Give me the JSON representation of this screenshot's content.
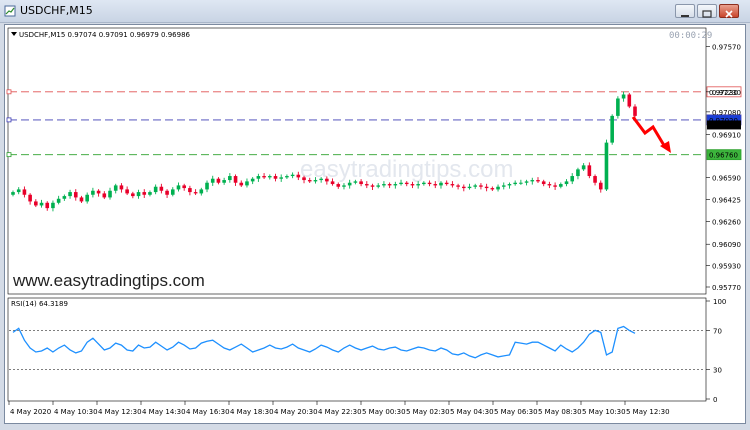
{
  "window": {
    "title": "USDCHF,M15",
    "buttons": [
      "minimize-icon",
      "restore-icon",
      "close-icon"
    ]
  },
  "chart_header": {
    "symbol_line": "USDCHF,M15  0.97074 0.97091 0.96979 0.96986",
    "timer": "00:00:29"
  },
  "watermarks": {
    "main": "www.easytradingtips.com",
    "faint": "easytradingtips.com"
  },
  "colors": {
    "bull": "#00b050",
    "bear": "#e8002a",
    "line_red": "#e05050",
    "line_blue": "#3c3cb4",
    "line_green": "#2ca02c",
    "rsi": "#1e90ff",
    "arrow": "#ff0000"
  },
  "chart_data": {
    "type": "candlestick",
    "price_axis_ticks": [
      "0.97570",
      "0.97230",
      "0.97080",
      "0.96910",
      "0.96590",
      "0.96425",
      "0.96260",
      "0.96090",
      "0.95930",
      "0.95770"
    ],
    "ylim": [
      0.9577,
      0.9767
    ],
    "horizontal_lines": [
      {
        "label": "0.97230",
        "value": 0.9723,
        "color": "red"
      },
      {
        "label": "0.97020",
        "value": 0.9702,
        "color": "blue"
      },
      {
        "label": "0.96760",
        "value": 0.9676,
        "color": "green"
      }
    ],
    "current_price_label": "0.96986",
    "time_labels": [
      "4 May 2020",
      "4 May 10:30",
      "4 May 12:30",
      "4 May 14:30",
      "4 May 16:30",
      "4 May 18:30",
      "4 May 20:30",
      "4 May 22:30",
      "5 May 00:30",
      "5 May 02:30",
      "5 May 04:30",
      "5 May 06:30",
      "5 May 08:30",
      "5 May 10:30",
      "5 May 12:30"
    ],
    "closes": [
      0.9648,
      0.965,
      0.9646,
      0.9641,
      0.9638,
      0.964,
      0.9636,
      0.964,
      0.9643,
      0.9645,
      0.9648,
      0.9644,
      0.9641,
      0.9646,
      0.9649,
      0.9647,
      0.9644,
      0.9649,
      0.9653,
      0.965,
      0.9647,
      0.9645,
      0.9648,
      0.9646,
      0.9648,
      0.9652,
      0.9649,
      0.9646,
      0.965,
      0.9653,
      0.9651,
      0.9648,
      0.9647,
      0.965,
      0.9655,
      0.9658,
      0.9655,
      0.9657,
      0.966,
      0.9655,
      0.9653,
      0.9656,
      0.9658,
      0.966,
      0.9659,
      0.966,
      0.9658,
      0.9659,
      0.966,
      0.9661,
      0.9659,
      0.9657,
      0.9656,
      0.9657,
      0.9658,
      0.9656,
      0.9654,
      0.9652,
      0.9653,
      0.9655,
      0.9656,
      0.9654,
      0.9653,
      0.9652,
      0.9653,
      0.9654,
      0.9653,
      0.9654,
      0.9655,
      0.9654,
      0.9653,
      0.9654,
      0.9655,
      0.9654,
      0.9653,
      0.9655,
      0.9654,
      0.9653,
      0.9652,
      0.9651,
      0.9652,
      0.9653,
      0.9652,
      0.9651,
      0.965,
      0.9652,
      0.9653,
      0.9654,
      0.9655,
      0.9655,
      0.9656,
      0.9657,
      0.9656,
      0.9654,
      0.9653,
      0.9652,
      0.9654,
      0.9656,
      0.966,
      0.9665,
      0.9668,
      0.966,
      0.9655,
      0.965,
      0.9685,
      0.9705,
      0.9718,
      0.9721,
      0.9712,
      0.9705
    ],
    "rsi": {
      "label": "RSI(14) 64.3189",
      "levels": [
        70,
        30
      ],
      "axis_ticks": [
        "100",
        "70",
        "30",
        "0"
      ],
      "values": [
        68,
        72,
        60,
        52,
        48,
        49,
        52,
        48,
        52,
        55,
        50,
        47,
        49,
        58,
        62,
        56,
        50,
        52,
        57,
        55,
        50,
        49,
        55,
        52,
        53,
        58,
        54,
        50,
        53,
        58,
        55,
        51,
        52,
        57,
        59,
        60,
        56,
        52,
        50,
        53,
        56,
        52,
        48,
        50,
        52,
        55,
        52,
        51,
        53,
        56,
        52,
        50,
        48,
        51,
        55,
        53,
        50,
        48,
        52,
        55,
        52,
        50,
        52,
        54,
        51,
        50,
        52,
        53,
        50,
        49,
        51,
        53,
        52,
        50,
        49,
        52,
        50,
        46,
        45,
        47,
        44,
        42,
        45,
        47,
        45,
        43,
        44,
        45,
        58,
        57,
        56,
        58,
        58,
        55,
        52,
        49,
        55,
        51,
        48,
        52,
        58,
        66,
        70,
        68,
        45,
        48,
        72,
        74,
        70,
        67
      ]
    }
  }
}
